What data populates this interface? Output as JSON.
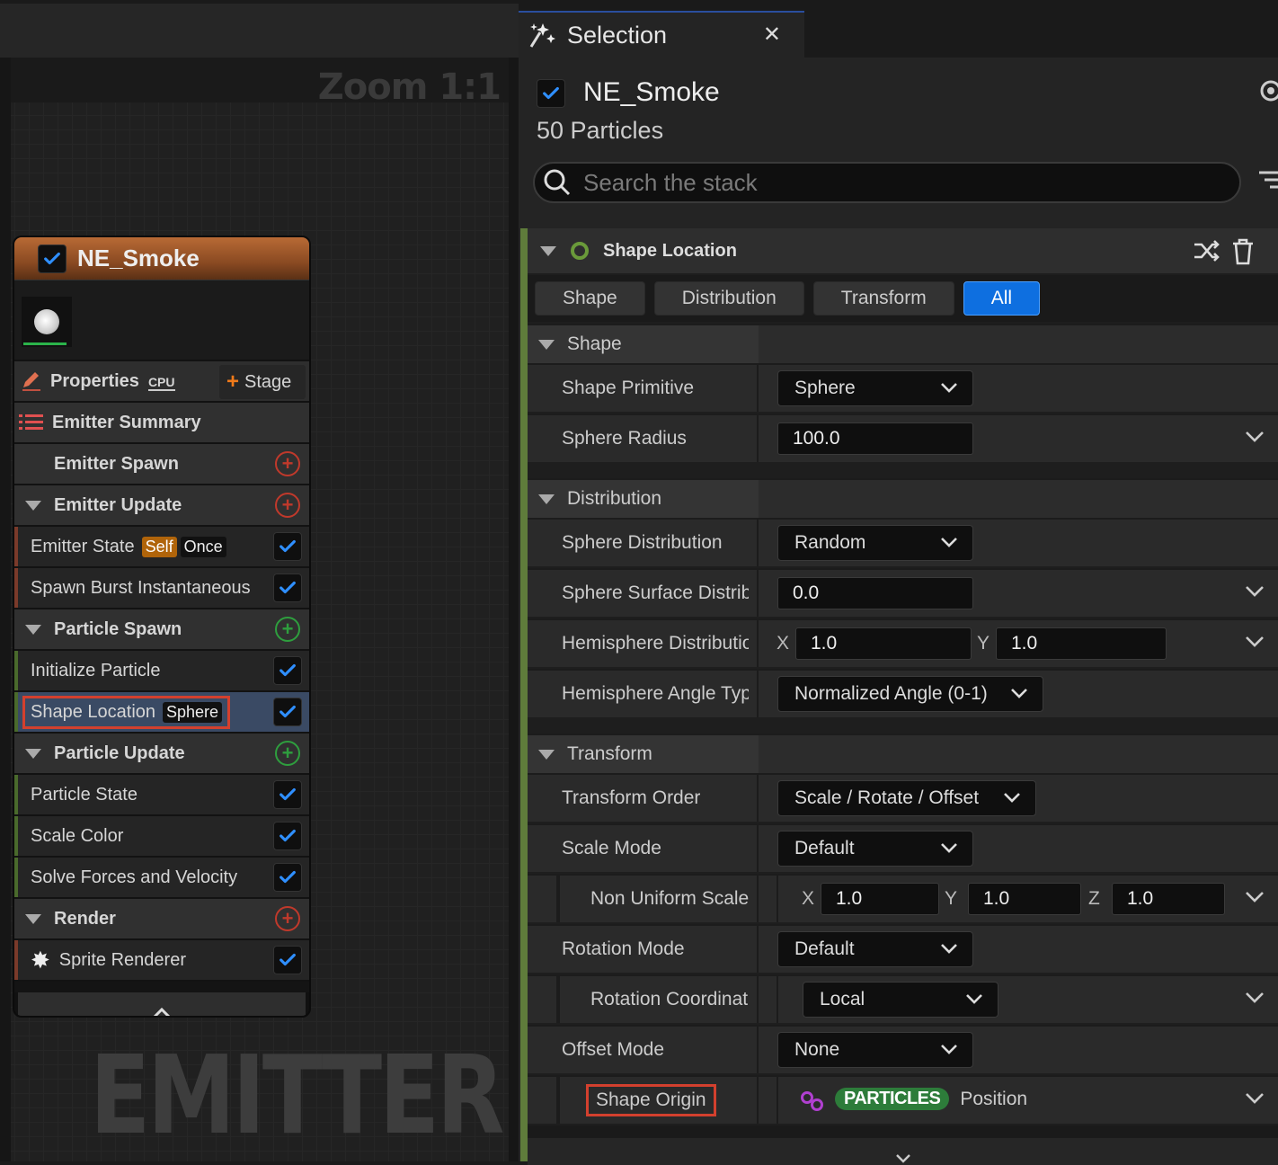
{
  "graph": {
    "zoom_label": "Zoom 1:1",
    "watermark": "EMITTER"
  },
  "node": {
    "title": "NE_Smoke",
    "properties_label": "Properties",
    "cpu_badge": "CPU",
    "stage_button": "Stage",
    "emitter_summary": "Emitter Summary",
    "groups": [
      {
        "label": "Emitter Spawn",
        "add_color": "#c0392b",
        "collapsible": false,
        "items": []
      },
      {
        "label": "Emitter Update",
        "add_color": "#c0392b",
        "collapsible": true,
        "items": [
          {
            "label": "Emitter State",
            "tags": [
              "Self",
              "Once"
            ],
            "checked": true
          },
          {
            "label": "Spawn Burst Instantaneous",
            "tags": [],
            "checked": true
          }
        ]
      },
      {
        "label": "Particle Spawn",
        "add_color": "#2e9e3e",
        "collapsible": true,
        "items": [
          {
            "label": "Initialize Particle",
            "tags": [],
            "checked": true
          },
          {
            "label": "Shape Location",
            "tags": [
              "Sphere"
            ],
            "checked": true,
            "selected": true
          }
        ]
      },
      {
        "label": "Particle Update",
        "add_color": "#2e9e3e",
        "collapsible": true,
        "items": [
          {
            "label": "Particle State",
            "tags": [],
            "checked": true
          },
          {
            "label": "Scale Color",
            "tags": [],
            "checked": true
          },
          {
            "label": "Solve Forces and Velocity",
            "tags": [],
            "checked": true
          }
        ]
      },
      {
        "label": "Render",
        "add_color": "#c0392b",
        "collapsible": true,
        "items": [
          {
            "label": "Sprite Renderer",
            "tags": [],
            "checked": true
          }
        ]
      }
    ]
  },
  "panel": {
    "tab_title": "Selection",
    "emitter_name": "NE_Smoke",
    "particle_count": "50 Particles",
    "search_placeholder": "Search the stack",
    "module_title": "Shape Location",
    "filter_tabs": [
      "Shape",
      "Distribution",
      "Transform",
      "All"
    ],
    "active_filter": "All",
    "categories": {
      "shape": "Shape",
      "distribution": "Distribution",
      "transform": "Transform"
    },
    "rows": {
      "shape_primitive": {
        "label": "Shape Primitive",
        "value": "Sphere"
      },
      "sphere_radius": {
        "label": "Sphere Radius",
        "value": "100.0"
      },
      "sphere_distribution": {
        "label": "Sphere Distribution",
        "value": "Random"
      },
      "sphere_surface": {
        "label": "Sphere Surface Distrib",
        "value": "0.0"
      },
      "hemisphere_dist": {
        "label": "Hemisphere Distributio",
        "x_label": "X",
        "x": "1.0",
        "y_label": "Y",
        "y": "1.0"
      },
      "hemisphere_angle": {
        "label": "Hemisphere Angle Typ",
        "value": "Normalized Angle (0-1)"
      },
      "transform_order": {
        "label": "Transform Order",
        "value": "Scale / Rotate / Offset"
      },
      "scale_mode": {
        "label": "Scale Mode",
        "value": "Default"
      },
      "non_uniform_scale": {
        "label": "Non Uniform Scale",
        "x_label": "X",
        "x": "1.0",
        "y_label": "Y",
        "y": "1.0",
        "z_label": "Z",
        "z": "1.0"
      },
      "rotation_mode": {
        "label": "Rotation Mode",
        "value": "Default"
      },
      "rotation_coord": {
        "label": "Rotation Coordinat",
        "value": "Local"
      },
      "offset_mode": {
        "label": "Offset Mode",
        "value": "None"
      },
      "shape_origin": {
        "label": "Shape Origin",
        "namespace": "PARTICLES",
        "value": "Position"
      }
    },
    "colors": {
      "accent_blue": "#0e6fe0",
      "module_green": "#5f7c3b",
      "highlight_red": "#d3402e"
    }
  }
}
